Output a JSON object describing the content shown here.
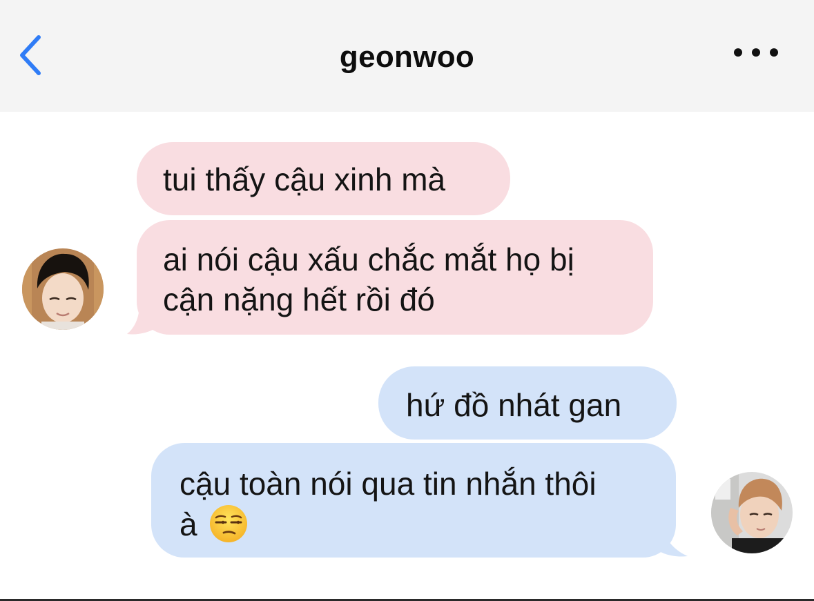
{
  "header": {
    "title": "geonwoo",
    "back_icon": "chevron-left-icon",
    "more_icon": "ellipsis-icon"
  },
  "messages": [
    {
      "from": "contact",
      "lines": [
        "tui thấy cậu xinh mà"
      ]
    },
    {
      "from": "contact",
      "lines": [
        "ai nói cậu xấu chắc mắt họ bị",
        "cận nặng hết rồi đó"
      ]
    },
    {
      "from": "self",
      "lines": [
        "hứ đồ nhát gan"
      ]
    },
    {
      "from": "self",
      "lines": [
        "cậu toàn nói qua tin nhắn thôi",
        "à"
      ],
      "emoji": "unamused-face-icon"
    }
  ],
  "colors": {
    "accent": "#2f7cf6",
    "incoming_bubble": "#f9dde1",
    "outgoing_bubble": "#d3e3f9",
    "header_bg": "#f4f4f4"
  }
}
